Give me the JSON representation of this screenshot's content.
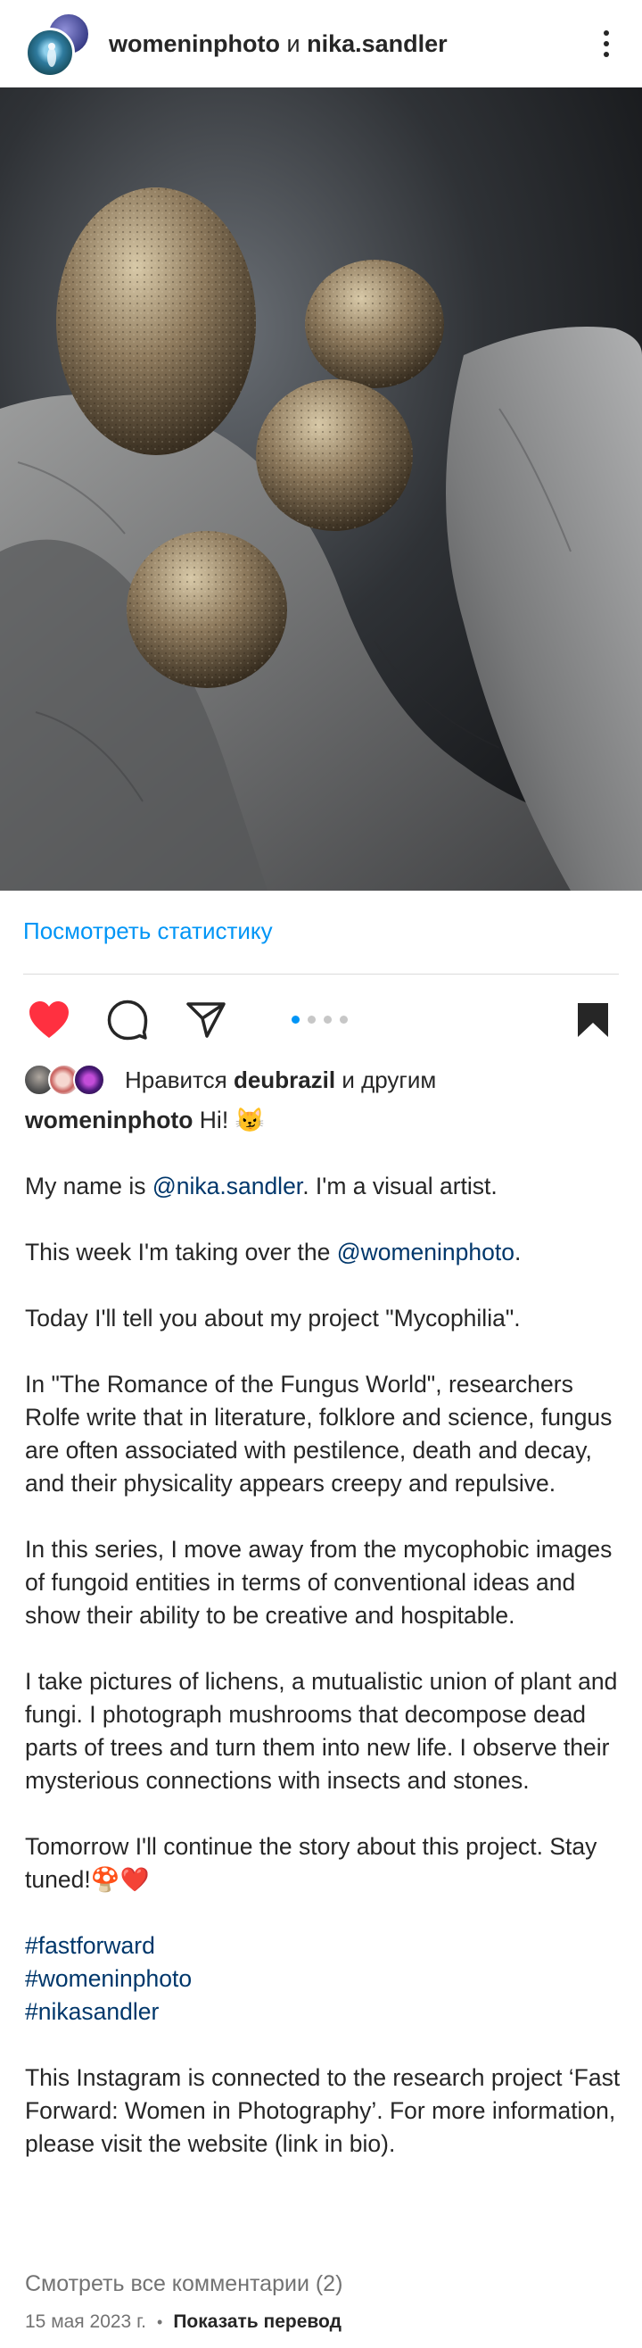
{
  "header": {
    "account_main": "womeninphoto",
    "conjunction": "и",
    "account_collab": "nika.sandler",
    "more_icon": "more-vertical-icon"
  },
  "post": {
    "image_subject": "mushrooms on stone",
    "carousel": {
      "total": 4,
      "active_index": 1
    }
  },
  "stats_link": "Посмотреть статистику",
  "actions": {
    "like_icon": "heart-filled-icon",
    "like_color": "#ff3040",
    "comment_icon": "comment-icon",
    "share_icon": "send-icon",
    "save_icon": "bookmark-filled-icon"
  },
  "likes": {
    "prefix": "Нравится",
    "user": "deubrazil",
    "suffix": "и другим"
  },
  "caption": {
    "username": "womeninphoto",
    "first_line": "Hi! 😼",
    "p2_a": "My name is ",
    "p2_mention": "@nika.sandler",
    "p2_b": ". I'm a visual artist.",
    "p3_a": "This week I'm taking over the ",
    "p3_mention": "@womeninphoto",
    "p3_b": ".",
    "p4": "Today I'll tell you about my project \"Mycophilia\".",
    "p5": "In \"The Romance of the Fungus World\", researchers Rolfe write that in literature, folklore and science, fungus are often associated with pestilence, death and decay, and their physicality appears creepy and repulsive.",
    "p6": "In this series, I move away from the mycophobic images of fungoid entities in terms of conventional ideas and show their ability to be creative and hospitable.",
    "p7": "I take pictures of lichens, a mutualistic union of plant and fungi. I photograph mushrooms that decompose dead parts of trees and turn them into new life. I observe their mysterious connections with insects and stones.",
    "p8": "Tomorrow I'll continue the story about this project. Stay tuned!🍄❤️",
    "hashtags": [
      "#fastforward",
      "#womeninphoto",
      "#nikasandler"
    ],
    "p10": "This Instagram is connected to the research project ‘Fast Forward: Women in Photography’. For more information, please visit the website (link in bio)."
  },
  "comments_link": "Смотреть все комментарии (2)",
  "date": "15 мая 2023 г.",
  "separator": "•",
  "translate_link": "Показать перевод"
}
